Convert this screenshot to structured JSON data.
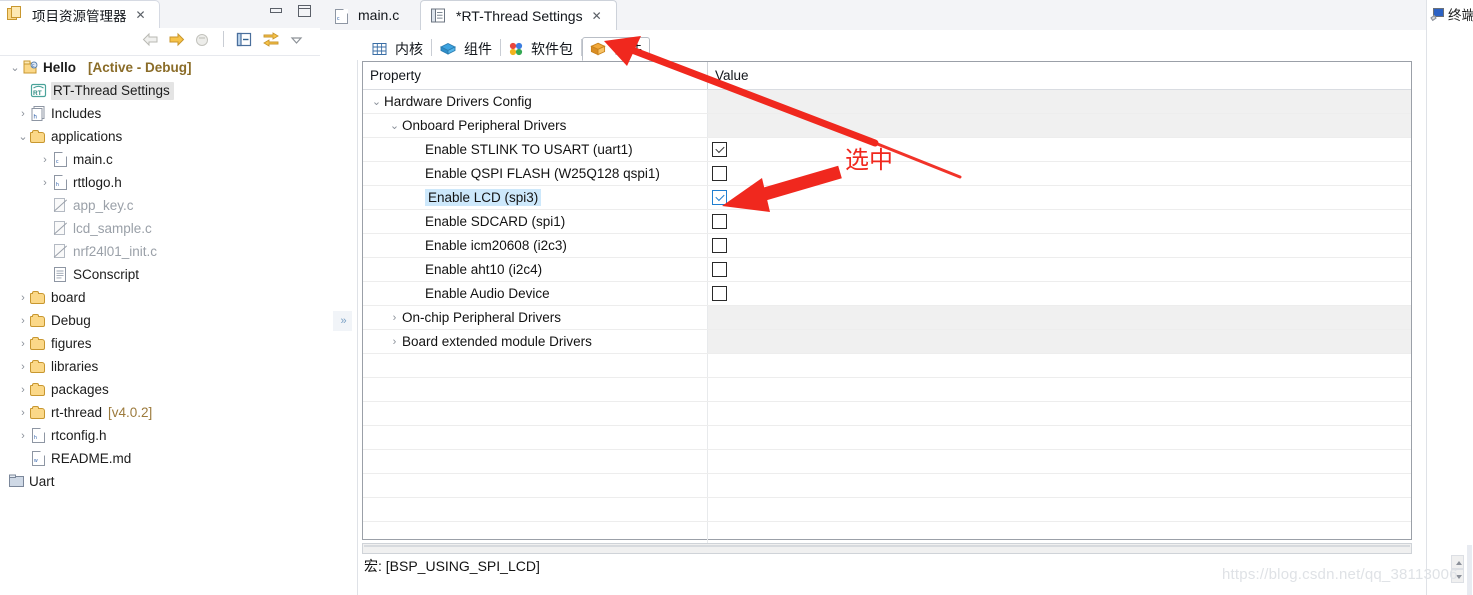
{
  "explorer": {
    "tab_title": "项目资源管理器",
    "tab_close": "✕",
    "toolbar_icons": [
      "back-arrow",
      "forward-arrow",
      "home-collapse",
      "collapse-all",
      "link-with-editor",
      "view-menu"
    ],
    "tree": [
      {
        "label": "Hello",
        "suffix": "[Active - Debug]",
        "icon": "project-icon",
        "twisty": "v",
        "indent": 0,
        "style": "bold"
      },
      {
        "label": "RT-Thread Settings",
        "icon": "rtthread-icon",
        "twisty": "",
        "indent": 1,
        "style": "selected"
      },
      {
        "label": "Includes",
        "icon": "includes-icon",
        "twisty": ">",
        "indent": 1,
        "style": "normal"
      },
      {
        "label": "applications",
        "icon": "folder-icon",
        "twisty": "v",
        "indent": 1,
        "style": "normal"
      },
      {
        "label": "main.c",
        "icon": "c-file-icon",
        "twisty": ">",
        "indent": 2,
        "style": "normal"
      },
      {
        "label": "rttlogo.h",
        "icon": "h-file-icon",
        "twisty": ">",
        "indent": 2,
        "style": "normal"
      },
      {
        "label": "app_key.c",
        "icon": "excluded-file-icon",
        "twisty": "",
        "indent": 2,
        "style": "dim"
      },
      {
        "label": "lcd_sample.c",
        "icon": "excluded-file-icon",
        "twisty": "",
        "indent": 2,
        "style": "dim"
      },
      {
        "label": "nrf24l01_init.c",
        "icon": "excluded-file-icon",
        "twisty": "",
        "indent": 2,
        "style": "dim"
      },
      {
        "label": "SConscript",
        "icon": "text-file-icon",
        "twisty": "",
        "indent": 2,
        "style": "normal"
      },
      {
        "label": "board",
        "icon": "folder-icon",
        "twisty": ">",
        "indent": 1,
        "style": "normal"
      },
      {
        "label": "Debug",
        "icon": "folder-icon",
        "twisty": ">",
        "indent": 1,
        "style": "normal"
      },
      {
        "label": "figures",
        "icon": "folder-icon",
        "twisty": ">",
        "indent": 1,
        "style": "normal"
      },
      {
        "label": "libraries",
        "icon": "folder-icon",
        "twisty": ">",
        "indent": 1,
        "style": "normal"
      },
      {
        "label": "packages",
        "icon": "folder-icon",
        "twisty": ">",
        "indent": 1,
        "style": "normal"
      },
      {
        "label": "rt-thread",
        "suffix": "[v4.0.2]",
        "icon": "folder-icon",
        "twisty": ">",
        "indent": 1,
        "style": "normal"
      },
      {
        "label": "rtconfig.h",
        "icon": "h-file-icon",
        "twisty": ">",
        "indent": 1,
        "style": "normal"
      },
      {
        "label": "README.md",
        "icon": "md-file-icon",
        "twisty": "",
        "indent": 1,
        "style": "normal"
      },
      {
        "label": "Uart",
        "icon": "project-closed-icon",
        "twisty": "",
        "indent": 0,
        "style": "normal"
      }
    ]
  },
  "editor": {
    "tabs": [
      {
        "title": "main.c",
        "icon": "c-file-icon",
        "active": false,
        "close": ""
      },
      {
        "title": "*RT-Thread Settings",
        "icon": "settings-icon",
        "active": true,
        "close": "✕"
      }
    ],
    "inner_tabs": [
      {
        "label": "内核",
        "icon": "kernel-grid-icon",
        "selected": false
      },
      {
        "label": "组件",
        "icon": "component-cube-icon",
        "selected": false
      },
      {
        "label": "软件包",
        "icon": "packages-dots-icon",
        "selected": false
      },
      {
        "label": "硬件",
        "icon": "hardware-box-icon",
        "selected": true
      }
    ],
    "table": {
      "headers": {
        "property": "Property",
        "value": "Value"
      },
      "rows": [
        {
          "label": "Hardware Drivers Config",
          "indent": 0,
          "twisty": "v",
          "value_type": "shade",
          "checked": false,
          "selected": false
        },
        {
          "label": "Onboard Peripheral Drivers",
          "indent": 1,
          "twisty": "v",
          "value_type": "shade",
          "checked": false,
          "selected": false
        },
        {
          "label": "Enable STLINK TO USART (uart1)",
          "indent": 3,
          "twisty": "",
          "value_type": "checkbox",
          "checked": true,
          "selected": false
        },
        {
          "label": "Enable QSPI FLASH (W25Q128 qspi1)",
          "indent": 3,
          "twisty": "",
          "value_type": "checkbox",
          "checked": false,
          "selected": false
        },
        {
          "label": "Enable LCD (spi3)",
          "indent": 3,
          "twisty": "",
          "value_type": "checkbox-blue",
          "checked": true,
          "selected": true
        },
        {
          "label": "Enable SDCARD (spi1)",
          "indent": 3,
          "twisty": "",
          "value_type": "checkbox",
          "checked": false,
          "selected": false
        },
        {
          "label": "Enable icm20608 (i2c3)",
          "indent": 3,
          "twisty": "",
          "value_type": "checkbox",
          "checked": false,
          "selected": false
        },
        {
          "label": "Enable aht10 (i2c4)",
          "indent": 3,
          "twisty": "",
          "value_type": "checkbox",
          "checked": false,
          "selected": false
        },
        {
          "label": "Enable Audio Device",
          "indent": 3,
          "twisty": "",
          "value_type": "checkbox",
          "checked": false,
          "selected": false
        },
        {
          "label": "On-chip Peripheral Drivers",
          "indent": 1,
          "twisty": ">",
          "value_type": "shade",
          "checked": false,
          "selected": false
        },
        {
          "label": "Board extended module Drivers",
          "indent": 1,
          "twisty": ">",
          "value_type": "shade",
          "checked": false,
          "selected": false
        }
      ],
      "empty_row_count": 8
    },
    "macro_text": "宏: [BSP_USING_SPI_LCD]",
    "collapse_button": "»"
  },
  "right_panel": {
    "terminal_label": "终端",
    "terminal_icon": "terminal-icon"
  },
  "annotations": {
    "callout_text": "选中",
    "color": "#f0281e",
    "arrow_count": 2
  },
  "watermark": "https://blog.csdn.net/qq_38113006"
}
